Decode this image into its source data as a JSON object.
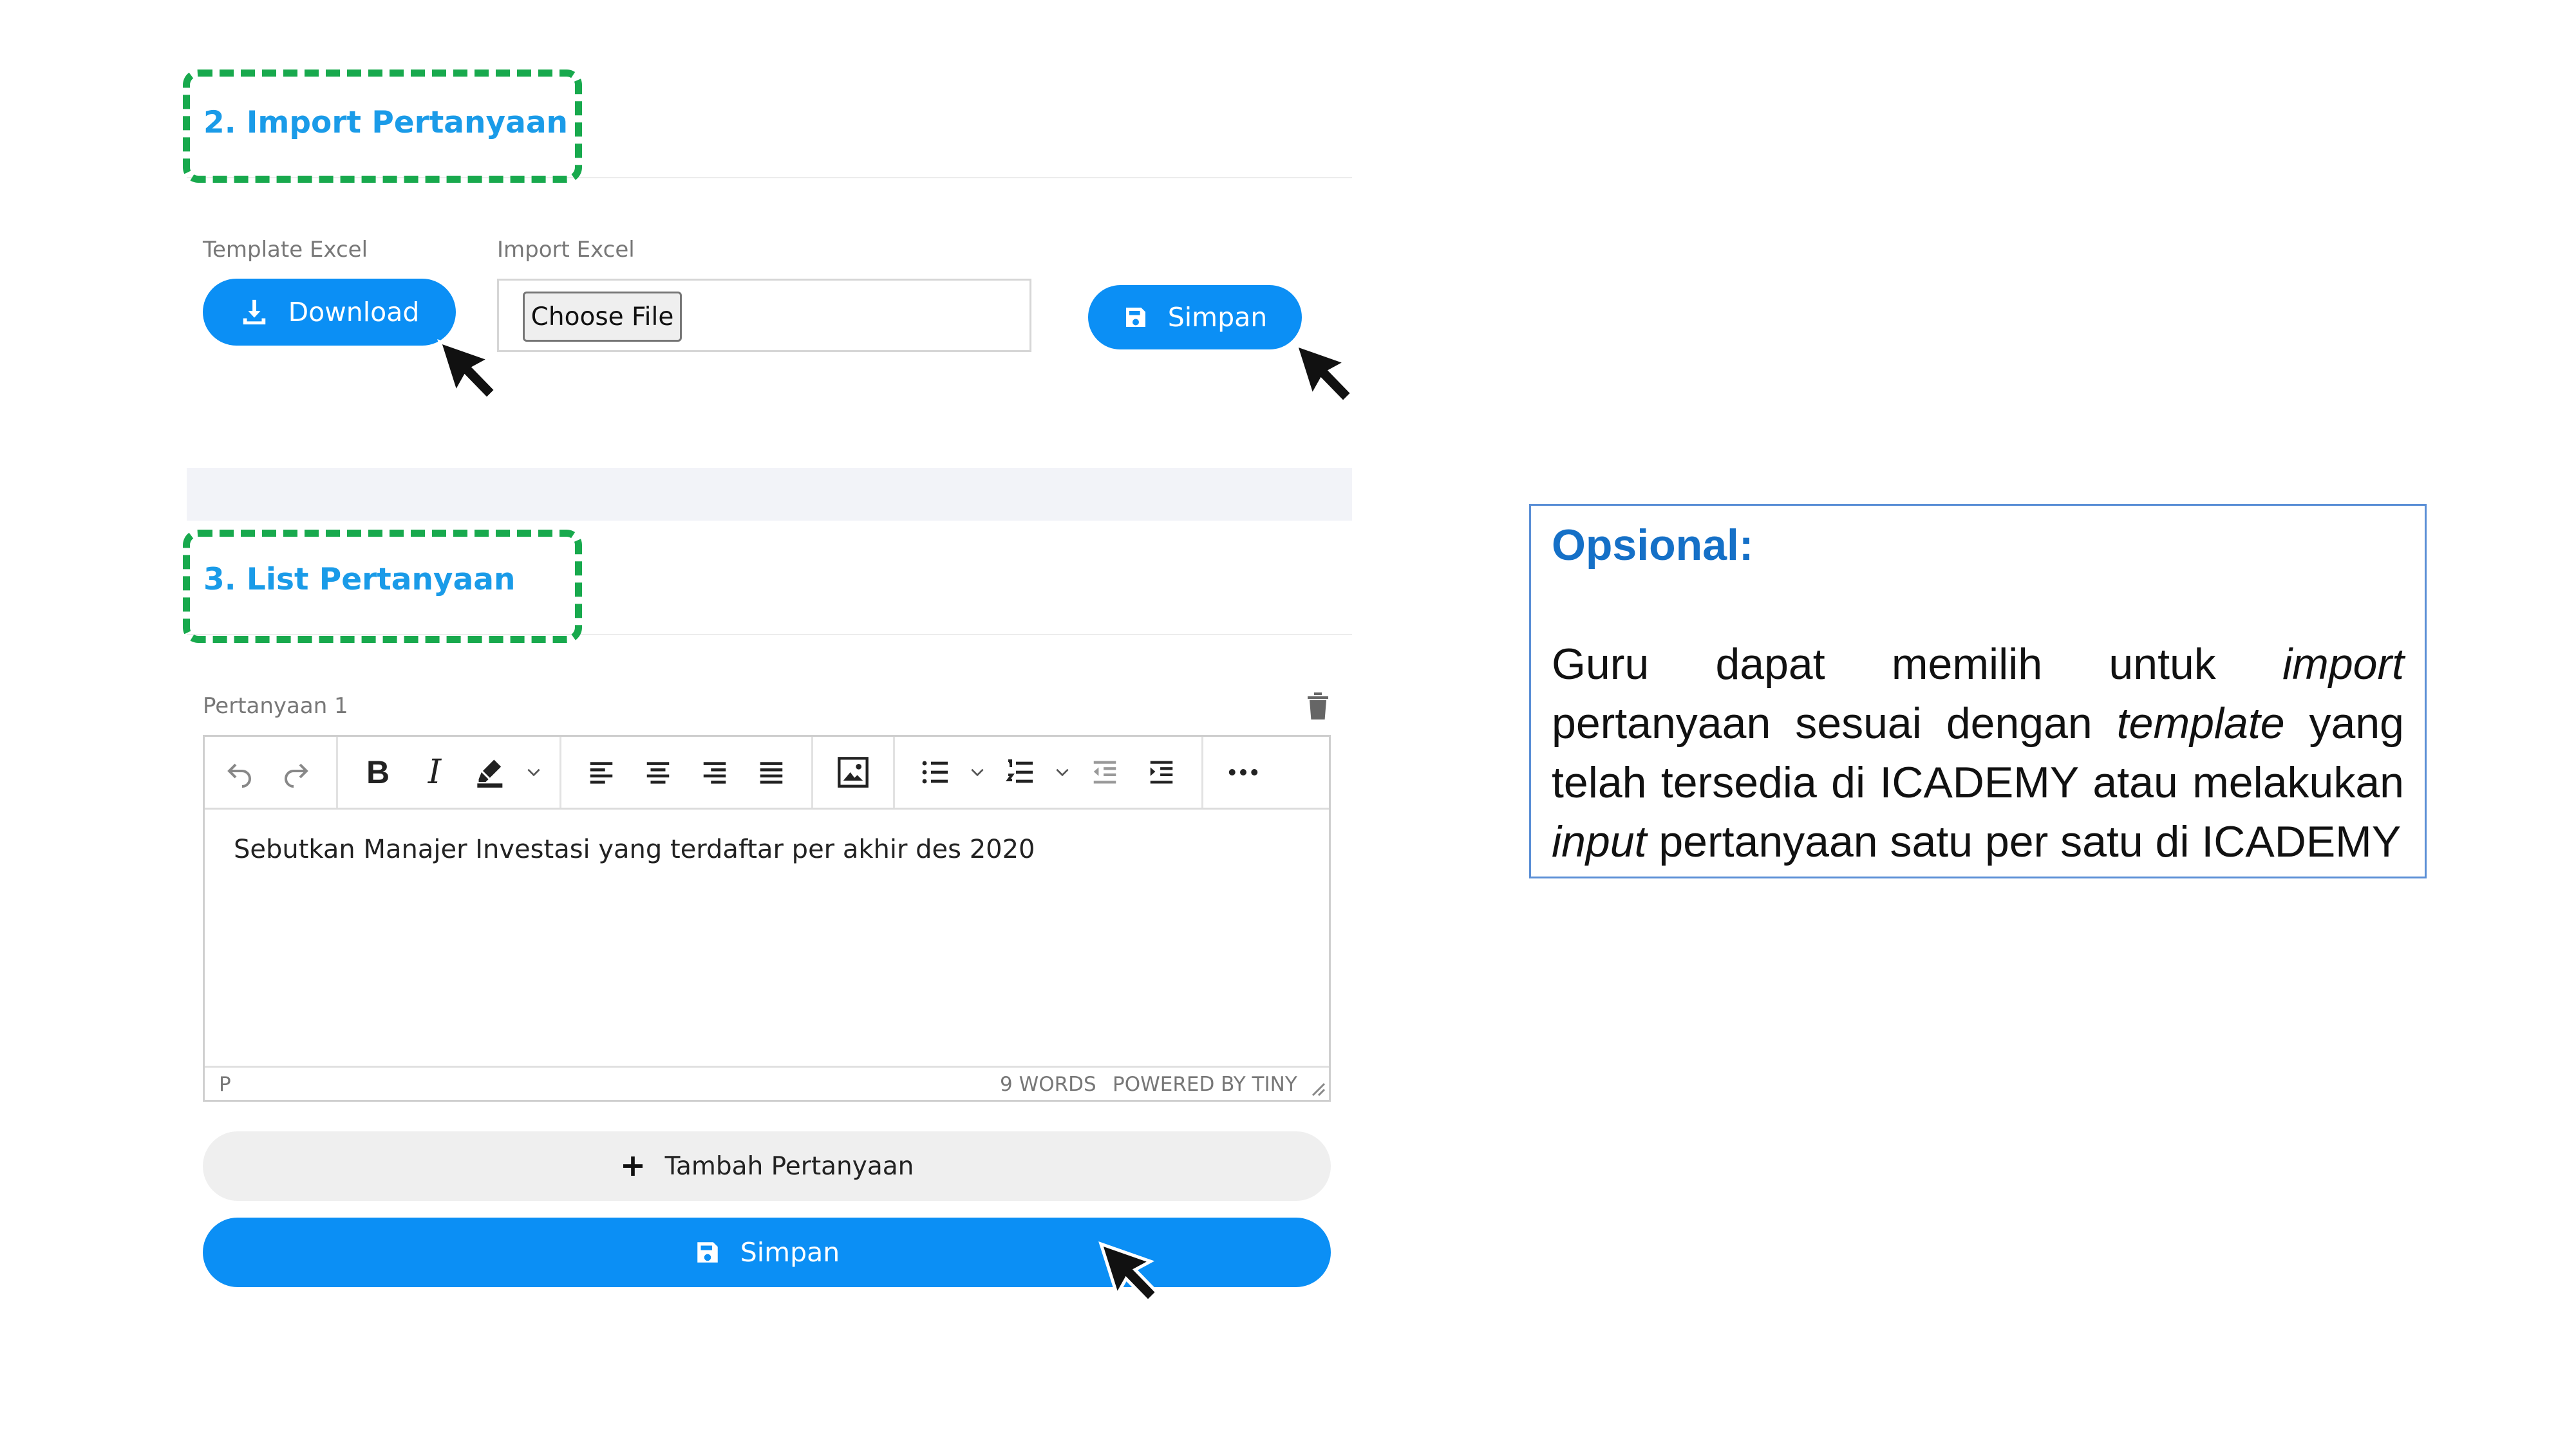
{
  "import_section": {
    "title": "2. Import Pertanyaan",
    "template_label": "Template Excel",
    "download_label": "Download",
    "import_label": "Import Excel",
    "choose_file_label": "Choose File",
    "save_label": "Simpan"
  },
  "list_section": {
    "title": "3. List Pertanyaan",
    "question_label": "Pertanyaan 1",
    "editor_content": "Sebutkan Manajer Investasi yang terdaftar per akhir des 2020",
    "status_path": "P",
    "status_words": "9 WORDS",
    "status_powered": "POWERED BY TINY",
    "add_question_label": "Tambah Pertanyaan",
    "save_label": "Simpan"
  },
  "note": {
    "title": "Opsional:",
    "text_parts": [
      "Guru dapat memilih untuk ",
      "import",
      " pertanyaan sesuai dengan ",
      "template",
      " yang telah tersedia di ICADEMY atau melakukan ",
      "input",
      " pertanyaan satu per satu di ICADEMY"
    ]
  },
  "colors": {
    "accent_blue": "#0b8ff5",
    "title_blue": "#1a9be8",
    "highlight_green": "#18a94d",
    "note_title_blue": "#1570c7",
    "note_border": "#5b8fd6"
  },
  "icons": [
    "download-icon",
    "save-icon",
    "undo-icon",
    "redo-icon",
    "bold-icon",
    "italic-icon",
    "highlight-icon",
    "align-left-icon",
    "align-center-icon",
    "align-right-icon",
    "align-justify-icon",
    "image-icon",
    "bullet-list-icon",
    "numbered-list-icon",
    "outdent-icon",
    "indent-icon",
    "more-icon",
    "trash-icon",
    "plus-icon",
    "cursor-arrow-icon"
  ]
}
